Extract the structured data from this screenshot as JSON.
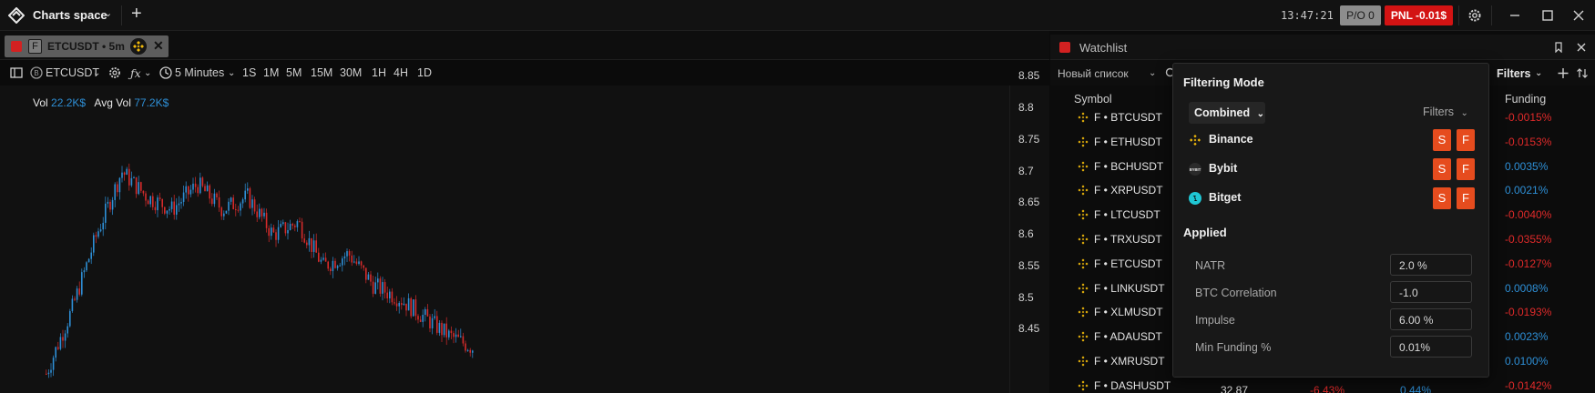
{
  "app": {
    "space_title": "Charts space",
    "clock": "13:47:21",
    "po_badge": "P/O 0",
    "pnl_badge": "PNL -0.01$"
  },
  "chart_tab": {
    "f_label": "F",
    "label": "ETCUSDT • 5m"
  },
  "toolbar": {
    "symbol": "ETCUSDT",
    "interval": "5 Minutes",
    "timeframes": [
      "1S",
      "1M",
      "5M",
      "15M",
      "30M",
      "1H",
      "4H",
      "1D"
    ]
  },
  "chart": {
    "vol_label": "Vol",
    "vol_value": "22.2K$",
    "avg_vol_label": "Avg Vol",
    "avg_vol_value": "77.2K$",
    "price_ticks": [
      "8.85",
      "8.8",
      "8.75",
      "8.7",
      "8.65",
      "8.6",
      "8.55",
      "8.5",
      "8.45"
    ],
    "up_color": "#2e8fd6",
    "down_color": "#d62b2b"
  },
  "chart_data": {
    "type": "candlestick",
    "title": "",
    "ylim": [
      8.42,
      8.86
    ],
    "y_ticks": [
      8.85,
      8.8,
      8.75,
      8.7,
      8.65,
      8.6,
      8.55,
      8.5,
      8.45
    ],
    "approx_close_path": [
      8.38,
      8.48,
      8.6,
      8.7,
      8.66,
      8.64,
      8.68,
      8.64,
      8.66,
      8.6,
      8.62,
      8.55,
      8.57,
      8.52,
      8.5,
      8.47,
      8.44,
      8.42
    ]
  },
  "watchlist": {
    "title": "Watchlist",
    "list_name": "Новый список",
    "filters_button": "Filters",
    "col_symbol": "Symbol",
    "col_funding": "Funding",
    "rows": [
      {
        "symbol": "F • BTCUSDT",
        "funding": "-0.0015%",
        "sign": "neg"
      },
      {
        "symbol": "F • ETHUSDT",
        "funding": "-0.0153%",
        "sign": "neg"
      },
      {
        "symbol": "F • BCHUSDT",
        "funding": "0.0035%",
        "sign": "pos"
      },
      {
        "symbol": "F • XRPUSDT",
        "funding": "0.0021%",
        "sign": "pos"
      },
      {
        "symbol": "F • LTCUSDT",
        "funding": "-0.0040%",
        "sign": "neg"
      },
      {
        "symbol": "F • TRXUSDT",
        "funding": "-0.0355%",
        "sign": "neg"
      },
      {
        "symbol": "F • ETCUSDT",
        "funding": "-0.0127%",
        "sign": "neg"
      },
      {
        "symbol": "F • LINKUSDT",
        "funding": "0.0008%",
        "sign": "pos"
      },
      {
        "symbol": "F • XLMUSDT",
        "funding": "-0.0193%",
        "sign": "neg"
      },
      {
        "symbol": "F • ADAUSDT",
        "funding": "0.0023%",
        "sign": "pos"
      },
      {
        "symbol": "F • XMRUSDT",
        "funding": "0.0100%",
        "sign": "pos"
      },
      {
        "symbol": "F • DASHUSDT",
        "funding": "-0.0142%",
        "sign": "neg"
      }
    ],
    "partial_row": {
      "value_a": "32.87",
      "value_b": "-6.43%",
      "value_c": "0.44%"
    }
  },
  "filter_popup": {
    "heading": "Filtering Mode",
    "mode": "Combined",
    "filters_label": "Filters",
    "exchanges": [
      {
        "name": "Binance",
        "s": "S",
        "f": "F"
      },
      {
        "name": "Bybit",
        "s": "S",
        "f": "F"
      },
      {
        "name": "Bitget",
        "s": "S",
        "f": "F"
      }
    ],
    "applied_heading": "Applied",
    "applied": [
      {
        "label": "NATR",
        "value": "2.0 %"
      },
      {
        "label": "BTC Correlation",
        "value": "-1.0"
      },
      {
        "label": "Impulse",
        "value": "6.00 %"
      },
      {
        "label": "Min Funding %",
        "value": "0.01%"
      }
    ]
  }
}
